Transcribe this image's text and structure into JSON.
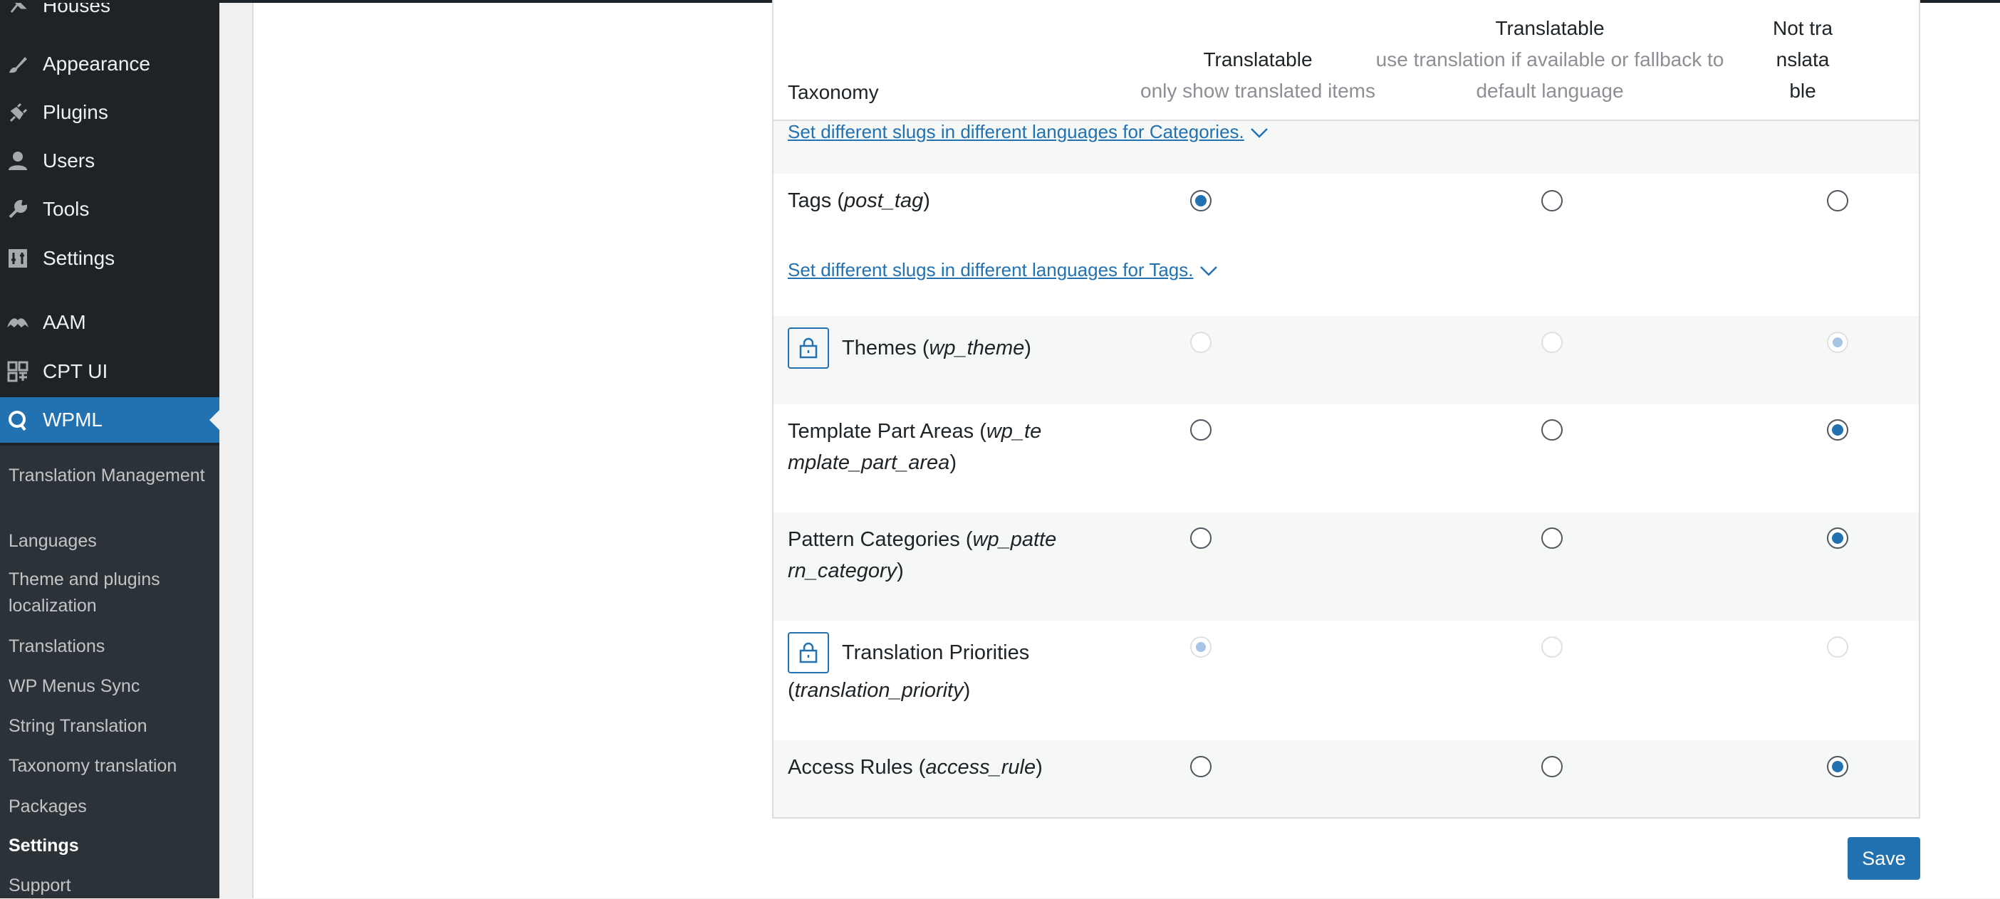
{
  "sidebar": {
    "items": [
      {
        "label": "Houses",
        "icon": "pin-icon"
      },
      {
        "label": "Appearance",
        "icon": "paintbrush-icon"
      },
      {
        "label": "Plugins",
        "icon": "plugin-icon"
      },
      {
        "label": "Users",
        "icon": "users-icon"
      },
      {
        "label": "Tools",
        "icon": "wrench-icon"
      },
      {
        "label": "Settings",
        "icon": "settings-icon"
      },
      {
        "label": "AAM",
        "icon": "aam-icon"
      },
      {
        "label": "CPT UI",
        "icon": "cpt-ui-icon"
      },
      {
        "label": "WPML",
        "icon": "wpml-icon",
        "active": true
      }
    ],
    "submenu": [
      {
        "label": "Translation Management"
      },
      {
        "label": "Languages"
      },
      {
        "label": "Theme and plugins localization"
      },
      {
        "label": "Translations"
      },
      {
        "label": "WP Menus Sync"
      },
      {
        "label": "String Translation"
      },
      {
        "label": "Taxonomy translation"
      },
      {
        "label": "Packages"
      },
      {
        "label": "Settings",
        "current": true
      },
      {
        "label": "Support"
      }
    ]
  },
  "table": {
    "headers": {
      "taxonomy": "Taxonomy",
      "col1_title": "Translatable",
      "col1_sub": "only show translated items",
      "col2_title": "Translatable",
      "col2_sub": "use translation if available or fallback to default language",
      "col3_title": "Not translatable"
    },
    "slug_links": {
      "categories": "Set different slugs in different languages for Categories.",
      "tags": "Set different slugs in different languages for Tags."
    },
    "rows": [
      {
        "name": "Tags",
        "slug": "post_tag",
        "selected": 1,
        "locked": false
      },
      {
        "name": "Themes",
        "slug": "wp_theme",
        "selected": 3,
        "locked": true
      },
      {
        "name": "Template Part Areas",
        "slug": "wp_template_part_area",
        "selected": 3,
        "locked": false
      },
      {
        "name": "Pattern Categories",
        "slug": "wp_pattern_category",
        "selected": 3,
        "locked": false
      },
      {
        "name": "Translation Priorities",
        "slug": "translation_priority",
        "selected": 1,
        "locked": true
      },
      {
        "name": "Access Rules",
        "slug": "access_rule",
        "selected": 3,
        "locked": false
      }
    ]
  },
  "actions": {
    "save_label": "Save"
  },
  "colors": {
    "accent": "#2271b1",
    "sidebar_bg": "#1d2327",
    "tab_accent": "#e35d2e"
  }
}
